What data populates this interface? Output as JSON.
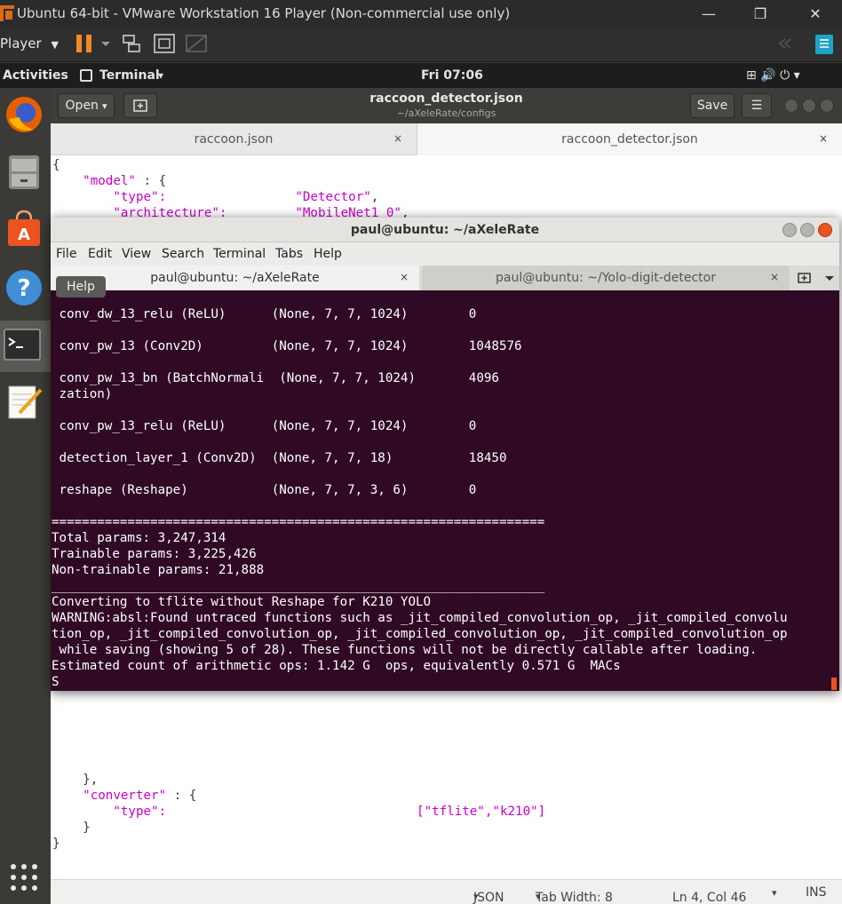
{
  "vm": {
    "title": "Ubuntu 64-bit - VMware Workstation 16 Player (Non-commercial use only)",
    "player_menu": "Player",
    "minimize": "—",
    "restore": "❐",
    "close": "✕"
  },
  "gnome": {
    "activities": "Activities",
    "app_menu": "Terminal",
    "app_menu_arrow": "▾",
    "clock": "Fri 07:06",
    "tray": "⊞  🔊  ⏻ ▾"
  },
  "gedit": {
    "open_label": "Open",
    "open_arrow": "▾",
    "title": "raccoon_detector.json",
    "subtitle": "~/aXeleRate/configs",
    "save_label": "Save",
    "menu_icon": "☰",
    "tabs": [
      {
        "label": "raccoon.json",
        "close": "×"
      },
      {
        "label": "raccoon_detector.json",
        "close": "×"
      }
    ],
    "lines_top": [
      {
        "text": "{"
      },
      {
        "indent": "    ",
        "key": "\"model\"",
        "rest": " : {"
      },
      {
        "indent": "        ",
        "key": "\"type\":",
        "pad": "                 ",
        "str": "\"Detector\"",
        "rest": ","
      },
      {
        "indent": "        ",
        "key": "\"architecture\":",
        "pad": "         ",
        "str": "\"MobileNet1_0\"",
        "rest": ","
      }
    ],
    "lines_bottom": [
      {
        "text": "    },"
      },
      {
        "indent": "    ",
        "key": "\"converter\"",
        "rest": " : {"
      },
      {
        "indent": "        ",
        "key": "\"type\":",
        "pad": "                                 ",
        "str": "[\"tflite\",\"k210\"]",
        "rest": ""
      },
      {
        "text": "    }"
      },
      {
        "text": "}"
      }
    ],
    "status": {
      "language": "JSON",
      "tab_width": "Tab Width: 8",
      "position": "Ln 4, Col 46",
      "mode": "INS",
      "arrow": "▾"
    }
  },
  "terminal": {
    "title": "paul@ubuntu: ~/aXeleRate",
    "menu": [
      "File",
      "Edit",
      "View",
      "Search",
      "Terminal",
      "Tabs",
      "Help"
    ],
    "tabs": [
      {
        "label": "paul@ubuntu: ~/aXeleRate",
        "close": "×"
      },
      {
        "label": "paul@ubuntu: ~/Yolo-digit-detector",
        "close": "×"
      }
    ],
    "help_tooltip": "Help",
    "lines": [
      " conv_dw_13_relu (ReLU)      (None, 7, 7, 1024)        0",
      "",
      " conv_pw_13 (Conv2D)         (None, 7, 7, 1024)        1048576",
      "",
      " conv_pw_13_bn (BatchNormali  (None, 7, 7, 1024)       4096",
      " zation)",
      "",
      " conv_pw_13_relu (ReLU)      (None, 7, 7, 1024)        0",
      "",
      " detection_layer_1 (Conv2D)  (None, 7, 7, 18)          18450",
      "",
      " reshape (Reshape)           (None, 7, 7, 3, 6)        0",
      "",
      "=================================================================",
      "Total params: 3,247,314",
      "Trainable params: 3,225,426",
      "Non-trainable params: 21,888",
      "_________________________________________________________________",
      "Converting to tflite without Reshape for K210 YOLO",
      "WARNING:absl:Found untraced functions such as _jit_compiled_convolution_op, _jit_compiled_convolu",
      "tion_op, _jit_compiled_convolution_op, _jit_compiled_convolution_op, _jit_compiled_convolution_op",
      " while saving (showing 5 of 28). These functions will not be directly callable after loading.",
      "Estimated count of arithmetic ops: 1.142 G  ops, equivalently 0.571 G  MACs",
      "S"
    ]
  }
}
